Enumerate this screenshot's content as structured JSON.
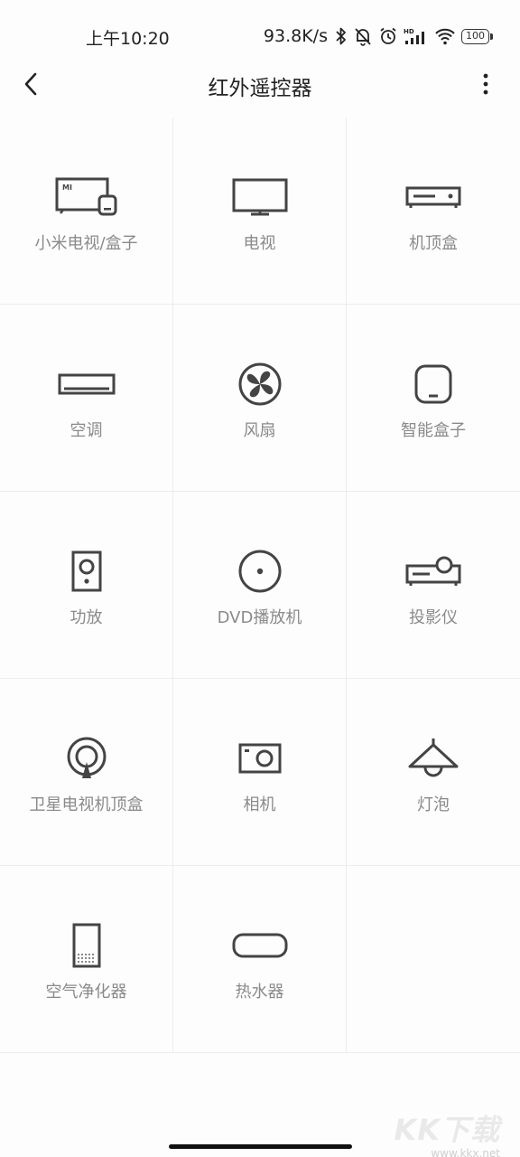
{
  "status_bar": {
    "time": "上午10:20",
    "net_speed": "93.8K/s",
    "battery": "100"
  },
  "title_bar": {
    "title": "红外遥控器"
  },
  "devices": [
    {
      "label": "小米电视/盒子",
      "icon": "mi-tv-box-icon"
    },
    {
      "label": "电视",
      "icon": "tv-icon"
    },
    {
      "label": "机顶盒",
      "icon": "set-top-box-icon"
    },
    {
      "label": "空调",
      "icon": "air-conditioner-icon"
    },
    {
      "label": "风扇",
      "icon": "fan-icon"
    },
    {
      "label": "智能盒子",
      "icon": "smart-box-icon"
    },
    {
      "label": "功放",
      "icon": "amplifier-icon"
    },
    {
      "label": "DVD播放机",
      "icon": "dvd-player-icon"
    },
    {
      "label": "投影仪",
      "icon": "projector-icon"
    },
    {
      "label": "卫星电视机顶盒",
      "icon": "satellite-box-icon"
    },
    {
      "label": "相机",
      "icon": "camera-icon"
    },
    {
      "label": "灯泡",
      "icon": "light-bulb-icon"
    },
    {
      "label": "空气净化器",
      "icon": "air-purifier-icon"
    },
    {
      "label": "热水器",
      "icon": "water-heater-icon"
    }
  ],
  "watermark": {
    "logo": "KK下载",
    "url": "www.kkx.net"
  }
}
